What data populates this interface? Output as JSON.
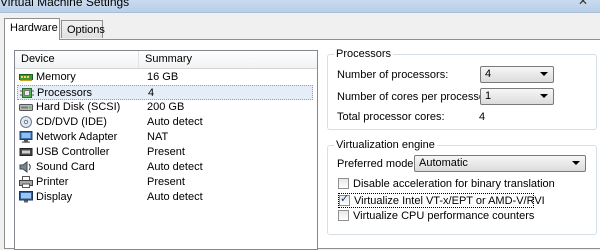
{
  "window": {
    "title": "Virtual Machine Settings",
    "close_glyph": "✕"
  },
  "tabs": [
    {
      "label": "Hardware",
      "active": true
    },
    {
      "label": "Options",
      "active": false
    }
  ],
  "device_list": {
    "columns": [
      "Device",
      "Summary"
    ],
    "rows": [
      {
        "device": "Memory",
        "summary": "16 GB",
        "icon": "memory-icon"
      },
      {
        "device": "Processors",
        "summary": "4",
        "icon": "processor-icon",
        "selected": true
      },
      {
        "device": "Hard Disk (SCSI)",
        "summary": "200 GB",
        "icon": "hard-disk-icon"
      },
      {
        "device": "CD/DVD (IDE)",
        "summary": "Auto detect",
        "icon": "cd-dvd-icon"
      },
      {
        "device": "Network Adapter",
        "summary": "NAT",
        "icon": "network-adapter-icon"
      },
      {
        "device": "USB Controller",
        "summary": "Present",
        "icon": "usb-controller-icon"
      },
      {
        "device": "Sound Card",
        "summary": "Auto detect",
        "icon": "sound-card-icon"
      },
      {
        "device": "Printer",
        "summary": "Present",
        "icon": "printer-icon"
      },
      {
        "device": "Display",
        "summary": "Auto detect",
        "icon": "display-icon"
      }
    ]
  },
  "processors": {
    "legend": "Processors",
    "num_processors_label": "Number of processors:",
    "num_processors_value": "4",
    "cores_label": "Number of cores per processor:",
    "cores_value": "1",
    "total_label": "Total processor cores:",
    "total_value": "4"
  },
  "virtualization": {
    "legend": "Virtualization engine",
    "preferred_mode_label": "Preferred mode:",
    "preferred_mode_value": "Automatic",
    "options": [
      {
        "label": "Disable acceleration for binary translation",
        "checked": false
      },
      {
        "label": "Virtualize Intel VT-x/EPT or AMD-V/RVI",
        "checked": true
      },
      {
        "label": "Virtualize CPU performance counters",
        "checked": false
      }
    ]
  },
  "colors": {
    "selection": "#e5eef8",
    "border": "#828790",
    "accent": "#7da2ce"
  }
}
